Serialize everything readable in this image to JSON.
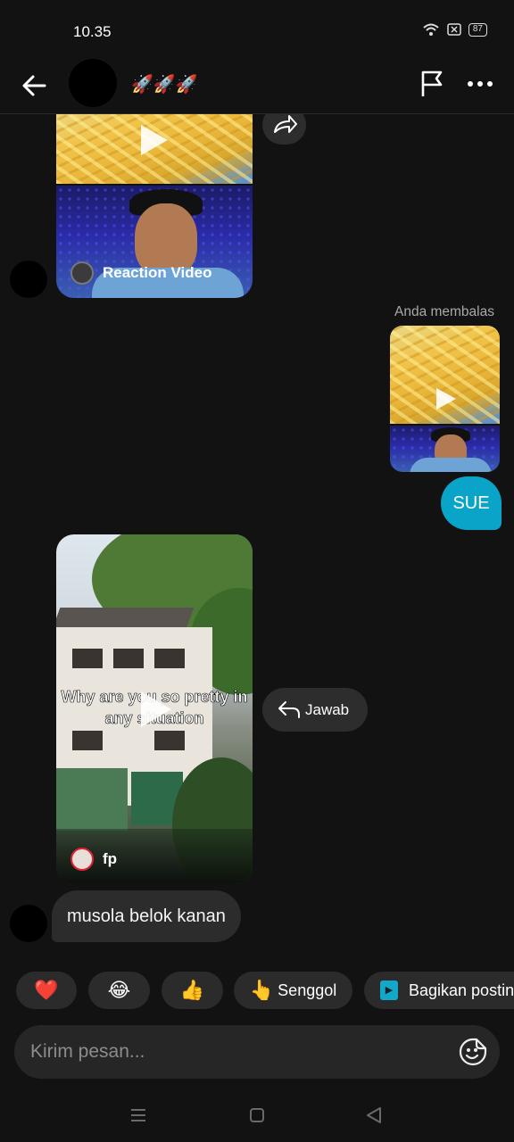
{
  "status_bar": {
    "time": "10.35",
    "battery": "87"
  },
  "header": {
    "title": "🚀🚀🚀"
  },
  "chat": {
    "reaction_video_label": "Reaction Video",
    "reply_label": "Anda membalas",
    "sent_message": "SUE",
    "video_caption_line1": "Why are you so pretty in",
    "video_caption_line2": "any situation",
    "video_user": "fp",
    "reply_button_label": "Jawab",
    "received_message": "musola belok kanan"
  },
  "quick_replies": [
    {
      "emoji": "❤️",
      "label": ""
    },
    {
      "emoji": "😂",
      "label": ""
    },
    {
      "emoji": "👍",
      "label": ""
    },
    {
      "emoji": "👆",
      "label": "Senggol"
    },
    {
      "emoji": "▶",
      "label": "Bagikan postin"
    }
  ],
  "composer": {
    "placeholder": "Kirim pesan..."
  },
  "colors": {
    "accent": "#0aa4c9",
    "background": "#121212",
    "bubble": "#2c2c2c"
  }
}
